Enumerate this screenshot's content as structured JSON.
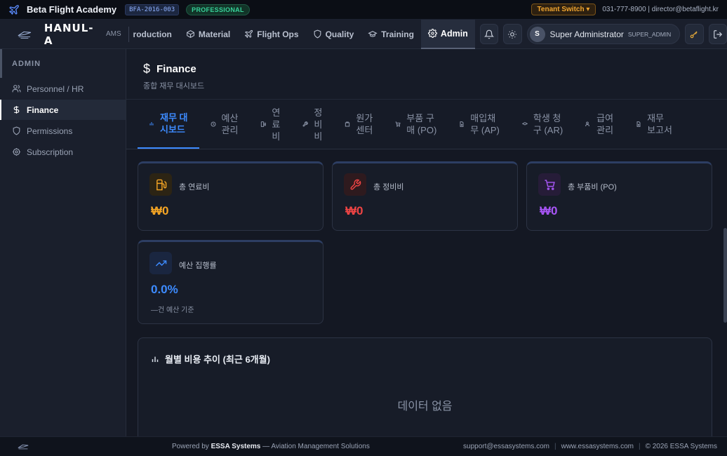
{
  "topbar": {
    "org_name": "Beta Flight Academy",
    "org_code": "BFA-2016-003",
    "plan": "PROFESSIONAL",
    "tenant_switch": "Tenant Switch ▾",
    "contact": "031-777-8900 | director@betaflight.kr"
  },
  "navbar": {
    "brand": "HANUL-A",
    "brand_sub": "AMS",
    "items": [
      {
        "label": "roduction",
        "icon": "none"
      },
      {
        "label": "Material",
        "icon": "box-icon"
      },
      {
        "label": "Flight Ops",
        "icon": "plane-icon"
      },
      {
        "label": "Quality",
        "icon": "shield-icon"
      },
      {
        "label": "Training",
        "icon": "graduation-cap-icon"
      },
      {
        "label": "Admin",
        "icon": "gear-icon"
      }
    ],
    "user": {
      "initial": "S",
      "name": "Super Administrator",
      "role": "SUPER_ADMIN"
    }
  },
  "sidebar": {
    "heading": "ADMIN",
    "items": [
      {
        "label": "Personnel / HR",
        "icon": "users-icon"
      },
      {
        "label": "Finance",
        "icon": "dollar-icon"
      },
      {
        "label": "Permissions",
        "icon": "shield-icon"
      },
      {
        "label": "Subscription",
        "icon": "gear-icon"
      }
    ]
  },
  "page": {
    "icon": "$",
    "title": "Finance",
    "subtitle": "종합 재무 대시보드"
  },
  "tabs": [
    {
      "line1": "재무 대",
      "line2": "시보드",
      "line3": ""
    },
    {
      "line1": "예산",
      "line2": "관리",
      "line3": ""
    },
    {
      "line1": "연",
      "line2": "료",
      "line3": "비"
    },
    {
      "line1": "정",
      "line2": "비",
      "line3": "비"
    },
    {
      "line1": "원가",
      "line2": "센터",
      "line3": ""
    },
    {
      "line1": "부품 구",
      "line2": "매 (PO)",
      "line3": ""
    },
    {
      "line1": "매입채",
      "line2": "무 (AP)",
      "line3": ""
    },
    {
      "line1": "학생 청",
      "line2": "구 (AR)",
      "line3": ""
    },
    {
      "line1": "급여",
      "line2": "관리",
      "line3": ""
    },
    {
      "line1": "재무",
      "line2": "보고서",
      "line3": ""
    }
  ],
  "cards": [
    {
      "label": "총 연료비",
      "value": "₩0",
      "icon": "fuel-icon",
      "color": "#f5a524"
    },
    {
      "label": "총 정비비",
      "value": "₩0",
      "icon": "wrench-icon",
      "color": "#ef4444"
    },
    {
      "label": "총 부품비 (PO)",
      "value": "₩0",
      "icon": "cart-icon",
      "color": "#a855f7"
    },
    {
      "label": "예산 집행률",
      "value": "0.0%",
      "note": "—건 예산 기준",
      "icon": "trending-up-icon",
      "color": "#3d8bff"
    }
  ],
  "chart": {
    "title": "월별 비용 추이 (최근 6개월)",
    "empty_text": "데이터 없음"
  },
  "footer": {
    "powered_prefix": "Powered by ",
    "powered_brand": "ESSA Systems",
    "powered_suffix": " — Aviation Management Solutions",
    "email": "support@essasystems.com",
    "website": "www.essasystems.com",
    "copyright": "© 2026 ESSA Systems"
  }
}
